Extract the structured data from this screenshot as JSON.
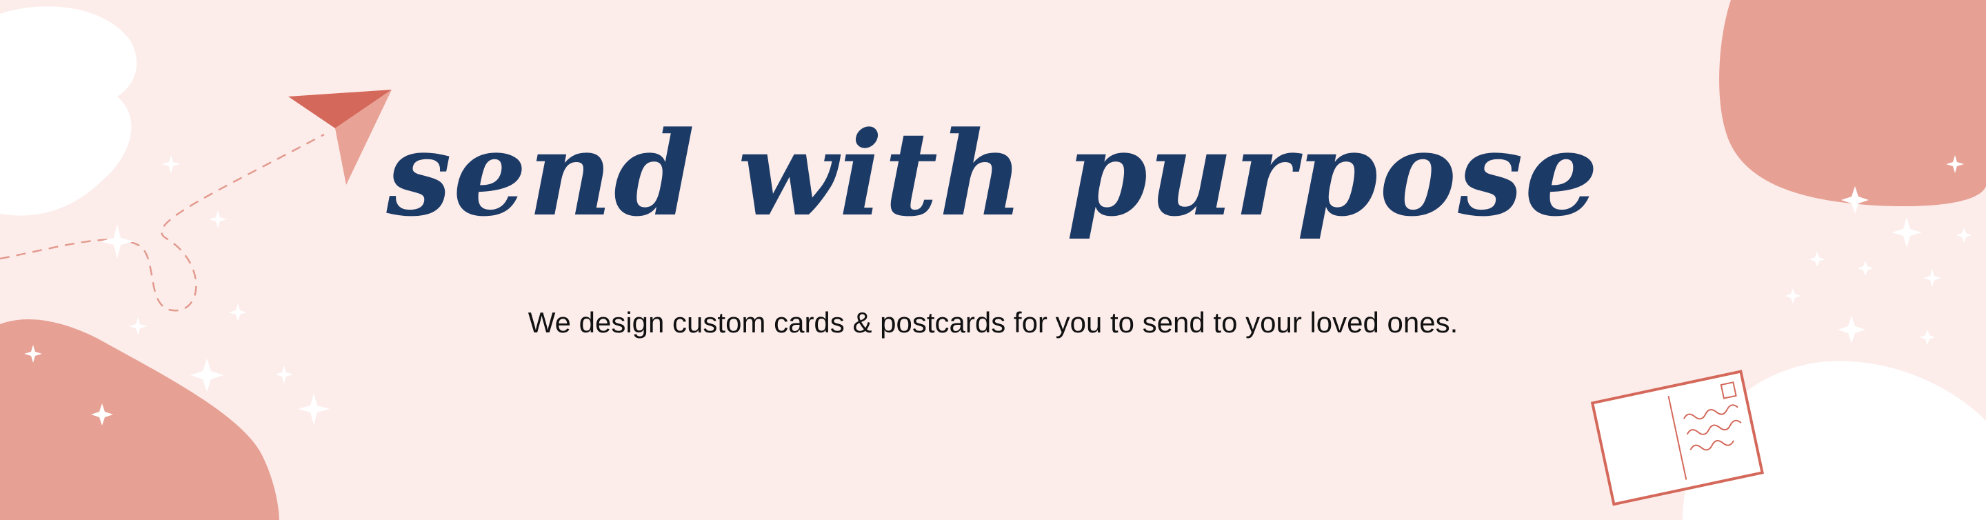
{
  "banner": {
    "headline": "send with purpose",
    "tagline": "We design custom cards & postcards for you to send to your loved ones."
  },
  "colors": {
    "background": "#fcedeb",
    "blob_pink": "#e7a094",
    "accent_red": "#d4685a",
    "plane_light": "#e9a296",
    "headline": "#1c3a66",
    "white": "#ffffff"
  },
  "decorations": [
    "paper-plane-icon",
    "sparkle-icon",
    "postcard-icon"
  ]
}
